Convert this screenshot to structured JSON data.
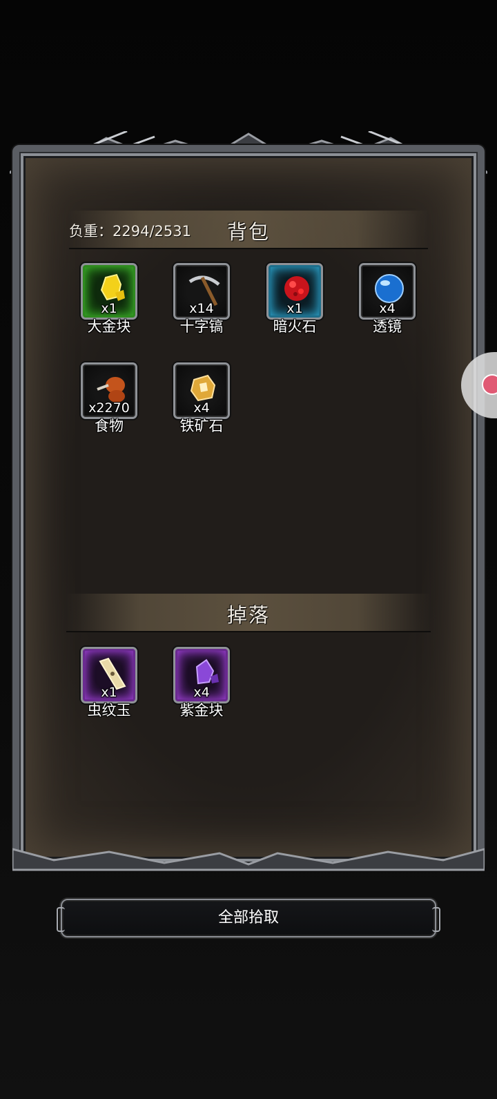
{
  "backpack": {
    "title": "背包",
    "weight_label": "负重：2294/2531",
    "items": [
      {
        "name": "大金块",
        "count": "x1",
        "rarity": "green",
        "icon": "gold-nugget-icon"
      },
      {
        "name": "十字镐",
        "count": "x14",
        "rarity": "plain",
        "icon": "pickaxe-icon"
      },
      {
        "name": "暗火石",
        "count": "x1",
        "rarity": "blue",
        "icon": "dark-fire-stone-icon"
      },
      {
        "name": "透镜",
        "count": "x4",
        "rarity": "plain",
        "icon": "lens-orb-icon"
      },
      {
        "name": "食物",
        "count": "x2270",
        "rarity": "plain",
        "icon": "food-drumstick-icon"
      },
      {
        "name": "铁矿石",
        "count": "x4",
        "rarity": "plain",
        "icon": "iron-ore-icon"
      }
    ]
  },
  "drops": {
    "title": "掉落",
    "items": [
      {
        "name": "虫纹玉",
        "count": "x1",
        "rarity": "purple",
        "icon": "bug-pattern-jade-icon"
      },
      {
        "name": "紫金块",
        "count": "x4",
        "rarity": "purple",
        "icon": "purple-gold-nugget-icon"
      }
    ]
  },
  "actions": {
    "pickup_all_label": "全部拾取"
  },
  "colors": {
    "green_rarity": "#2e8a1e",
    "blue_rarity": "#1e6f8c",
    "purple_rarity": "#6a2a90",
    "panel_bg": "#211d1a",
    "frame_metal": "#8c9096"
  }
}
